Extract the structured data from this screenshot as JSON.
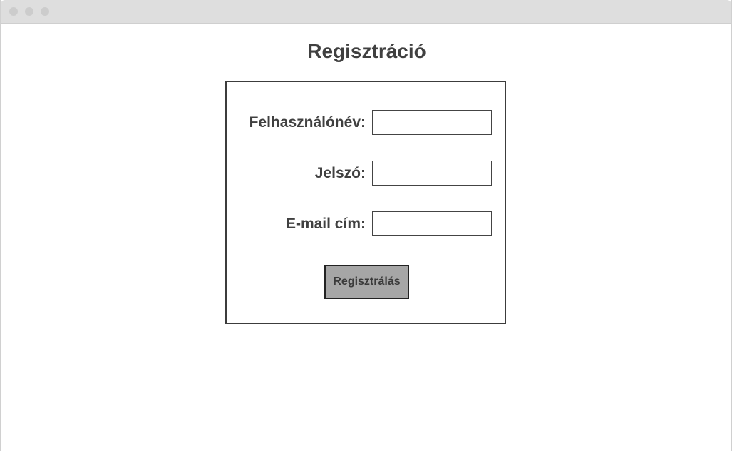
{
  "page": {
    "title": "Regisztráció"
  },
  "form": {
    "fields": [
      {
        "label": "Felhasználónév:",
        "value": "",
        "placeholder": ""
      },
      {
        "label": "Jelszó:",
        "value": "",
        "placeholder": ""
      },
      {
        "label": "E-mail cím:",
        "value": "",
        "placeholder": ""
      }
    ],
    "submit_label": "Regisztrálás"
  },
  "colors": {
    "titlebar": "#dedede",
    "text": "#404040",
    "button_bg": "#a6a6a6",
    "border": "#3c3c3c"
  }
}
